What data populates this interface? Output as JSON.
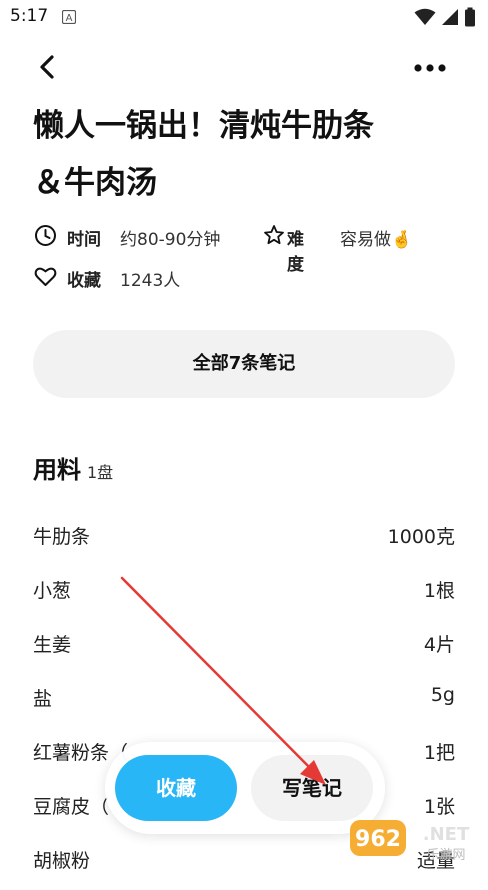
{
  "status_bar": {
    "time": "5:17",
    "icons": [
      "a-notification-icon",
      "wifi-icon",
      "signal-icon",
      "battery-icon"
    ]
  },
  "toolbar": {
    "back_icon": "back-arrow-icon",
    "more_icon": "more-dots-icon"
  },
  "recipe": {
    "title": "懒人一锅出！清炖牛肋条＆牛肉汤",
    "time_label": "时间",
    "time_value": "约80-90分钟",
    "difficulty_label": "难度",
    "difficulty_value": "容易做",
    "difficulty_emoji": "🤞",
    "favorites_label": "收藏",
    "favorites_value": "1243人"
  },
  "notes_button": "全部7条笔记",
  "ingredients": {
    "title": "用料",
    "servings": "1盘",
    "items": [
      {
        "name": "牛肋条",
        "qty": "1000克"
      },
      {
        "name": "小葱",
        "qty": "1根"
      },
      {
        "name": "生姜",
        "qty": "4片"
      },
      {
        "name": "盐",
        "qty": "5g"
      },
      {
        "name": "红薯粉条（",
        "qty": "1把"
      },
      {
        "name": "豆腐皮（",
        "qty": "1张"
      },
      {
        "name": "胡椒粉",
        "qty": "适量"
      }
    ]
  },
  "action_bar": {
    "favorite_label": "收藏",
    "write_note_label": "写笔记"
  },
  "watermark": {
    "text": "962.NET",
    "subtext": "乐游网"
  },
  "colors": {
    "accent": "#29b6f6",
    "annotation_arrow": "#e53935",
    "pill_bg": "#f2f2f2"
  }
}
